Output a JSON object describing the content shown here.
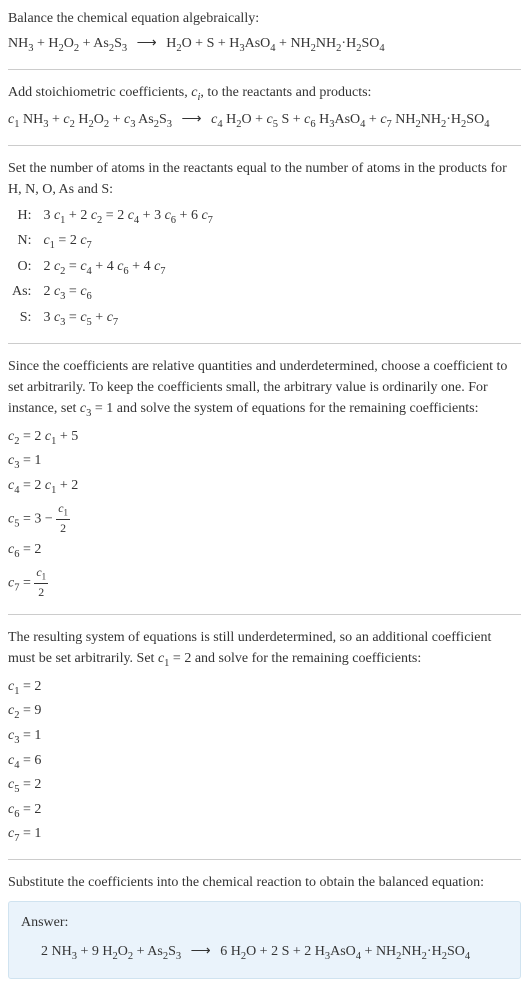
{
  "intro": {
    "line1": "Balance the chemical equation algebraically:",
    "eq1_lhs": "NH",
    "eq1": "NH₃ + H₂O₂ + As₂S₃  ⟶  H₂O + S + H₃AsO₄ + NH₂NH₂·H₂SO₄"
  },
  "step1": {
    "text": "Add stoichiometric coefficients, ",
    "ci": "c",
    "text2": ", to the reactants and products:",
    "eq": "c₁ NH₃ + c₂ H₂O₂ + c₃ As₂S₃  ⟶  c₄ H₂O + c₅ S + c₆ H₃AsO₄ + c₇ NH₂NH₂·H₂SO₄"
  },
  "step2": {
    "text": "Set the number of atoms in the reactants equal to the number of atoms in the products for H, N, O, As and S:",
    "rows": [
      {
        "label": "H:",
        "eq": "3 c₁ + 2 c₂ = 2 c₄ + 3 c₆ + 6 c₇"
      },
      {
        "label": "N:",
        "eq": "c₁ = 2 c₇"
      },
      {
        "label": "O:",
        "eq": "2 c₂ = c₄ + 4 c₆ + 4 c₇"
      },
      {
        "label": "As:",
        "eq": "2 c₃ = c₆"
      },
      {
        "label": "S:",
        "eq": "3 c₃ = c₅ + c₇"
      }
    ]
  },
  "step3": {
    "text": "Since the coefficients are relative quantities and underdetermined, choose a coefficient to set arbitrarily. To keep the coefficients small, the arbitrary value is ordinarily one. For instance, set c₃ = 1 and solve the system of equations for the remaining coefficients:",
    "coefs": [
      "c₂ = 2 c₁ + 5",
      "c₃ = 1",
      "c₄ = 2 c₁ + 2"
    ],
    "c5_prefix": "c₅ = 3 − ",
    "c5_num": "c₁",
    "c5_den": "2",
    "c6": "c₆ = 2",
    "c7_prefix": "c₇ = ",
    "c7_num": "c₁",
    "c7_den": "2"
  },
  "step4": {
    "text": "The resulting system of equations is still underdetermined, so an additional coefficient must be set arbitrarily. Set c₁ = 2 and solve for the remaining coefficients:",
    "coefs": [
      "c₁ = 2",
      "c₂ = 9",
      "c₃ = 1",
      "c₄ = 6",
      "c₅ = 2",
      "c₆ = 2",
      "c₇ = 1"
    ]
  },
  "step5": {
    "text": "Substitute the coefficients into the chemical reaction to obtain the balanced equation:"
  },
  "answer": {
    "label": "Answer:",
    "eq": "2 NH₃ + 9 H₂O₂ + As₂S₃  ⟶  6 H₂O + 2 S + 2 H₃AsO₄ + NH₂NH₂·H₂SO₄"
  }
}
